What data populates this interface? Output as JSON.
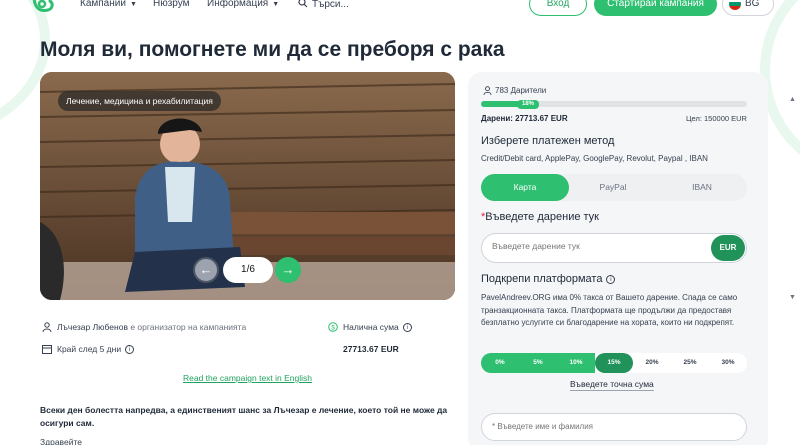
{
  "nav": {
    "links": [
      "Кампании",
      "Нюзрум",
      "Информация"
    ],
    "search_placeholder": "Търси...",
    "login": "Вход",
    "start_campaign": "Стартирай кампания",
    "language": "BG"
  },
  "page_title": "Моля ви, помогнете ми да се преборя с рака",
  "hero": {
    "category": "Лечение, медицина и рехабилитация",
    "slide_counter": "1/6"
  },
  "organizer": {
    "name": "Лъчезар Любенов",
    "role": "е организатор на кампанията",
    "ends": "Край след 5 дни",
    "available_label": "Налична сума",
    "available_value": "27713.67 EUR"
  },
  "read_english": "Read the campaign text in English",
  "description": "Всеки ден болестта напредва, а единственият шанс за Лъчезар е лечение, което той не може да осигури сам.",
  "description_more": "Здравейте",
  "panel": {
    "donors": "783 Дарители",
    "progress_pct": 18,
    "progress_label": "18%",
    "donated": "Дарени: 27713.67 EUR",
    "goal": "Цел: 150000 EUR",
    "payment_heading": "Изберете платежен метод",
    "payment_methods": "Credit/Debit card, ApplePay, GooglePay, Revolut, Paypal , IBAN",
    "tabs": [
      "Карта",
      "PayPal",
      "IBAN"
    ],
    "active_tab": 0,
    "donation_heading": "Въведете дарение тук",
    "donation_placeholder": "Въведете дарение тук",
    "currency": "EUR",
    "support_heading": "Подкрепи платформата",
    "support_text": "PavelAndreev.ORG има 0% такса от Вашето дарение. Спада се само транзакционната такса. Платформата ще продължи да предоставя безплатно услугите си благодарение на хората, които ни подкрепят.",
    "percentages": [
      "0%",
      "5%",
      "10%",
      "15%",
      "20%",
      "25%",
      "30%"
    ],
    "selected_pct": 3,
    "exact_amount": "Въведете точна сума",
    "name_placeholder": "* Въведете име и фамилия"
  },
  "colors": {
    "accent": "#2fbf71",
    "accent_dark": "#21925a"
  }
}
